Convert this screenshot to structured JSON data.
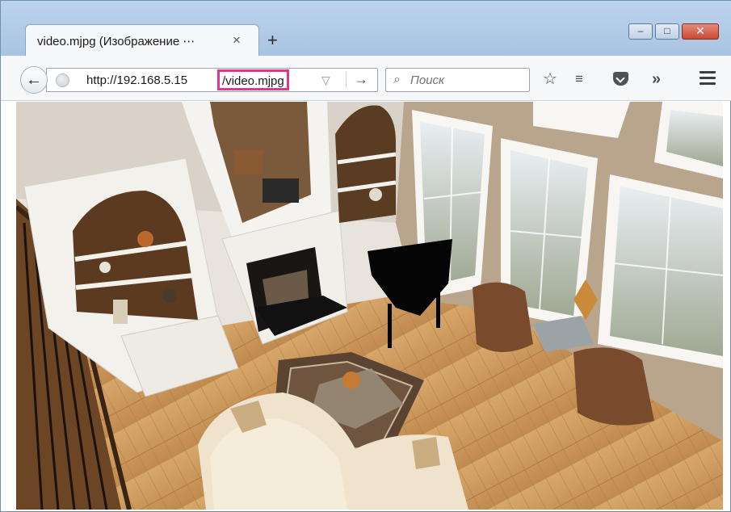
{
  "window": {
    "tab_title": "video.mjpg (Изображение ⋯",
    "tab_close_glyph": "×",
    "new_tab_glyph": "+",
    "controls": {
      "minimize_glyph": "–",
      "maximize_glyph": "□",
      "close_glyph": "✕"
    }
  },
  "navbar": {
    "back_glyph": "←",
    "url_host": "http://192.168.5.15",
    "url_path": "/video.mjpg",
    "dropmarker_glyph": "▽",
    "go_glyph": "→",
    "search_placeholder": "Поиск",
    "search_glyph": "⌕",
    "bookmark_glyph": "☆",
    "reading_list_glyph": "≡",
    "overflow_glyph": "»"
  },
  "icons": {
    "back": "back-arrow-icon",
    "identity": "globe-icon",
    "dropmarker": "dropmarker-icon",
    "go": "go-arrow-icon",
    "search": "search-icon",
    "bookmark": "bookmark-star-icon",
    "reading_list": "reading-list-icon",
    "pocket": "pocket-icon",
    "overflow": "overflow-icon",
    "menu": "hamburger-menu-icon"
  },
  "colors": {
    "url_highlight": "#e2368d",
    "titlebar": "#b4cde9",
    "close_button": "#c94a36",
    "floor": "#c69a62"
  },
  "content": {
    "type": "image",
    "description_name": "mjpeg-camera-frame-living-room"
  }
}
